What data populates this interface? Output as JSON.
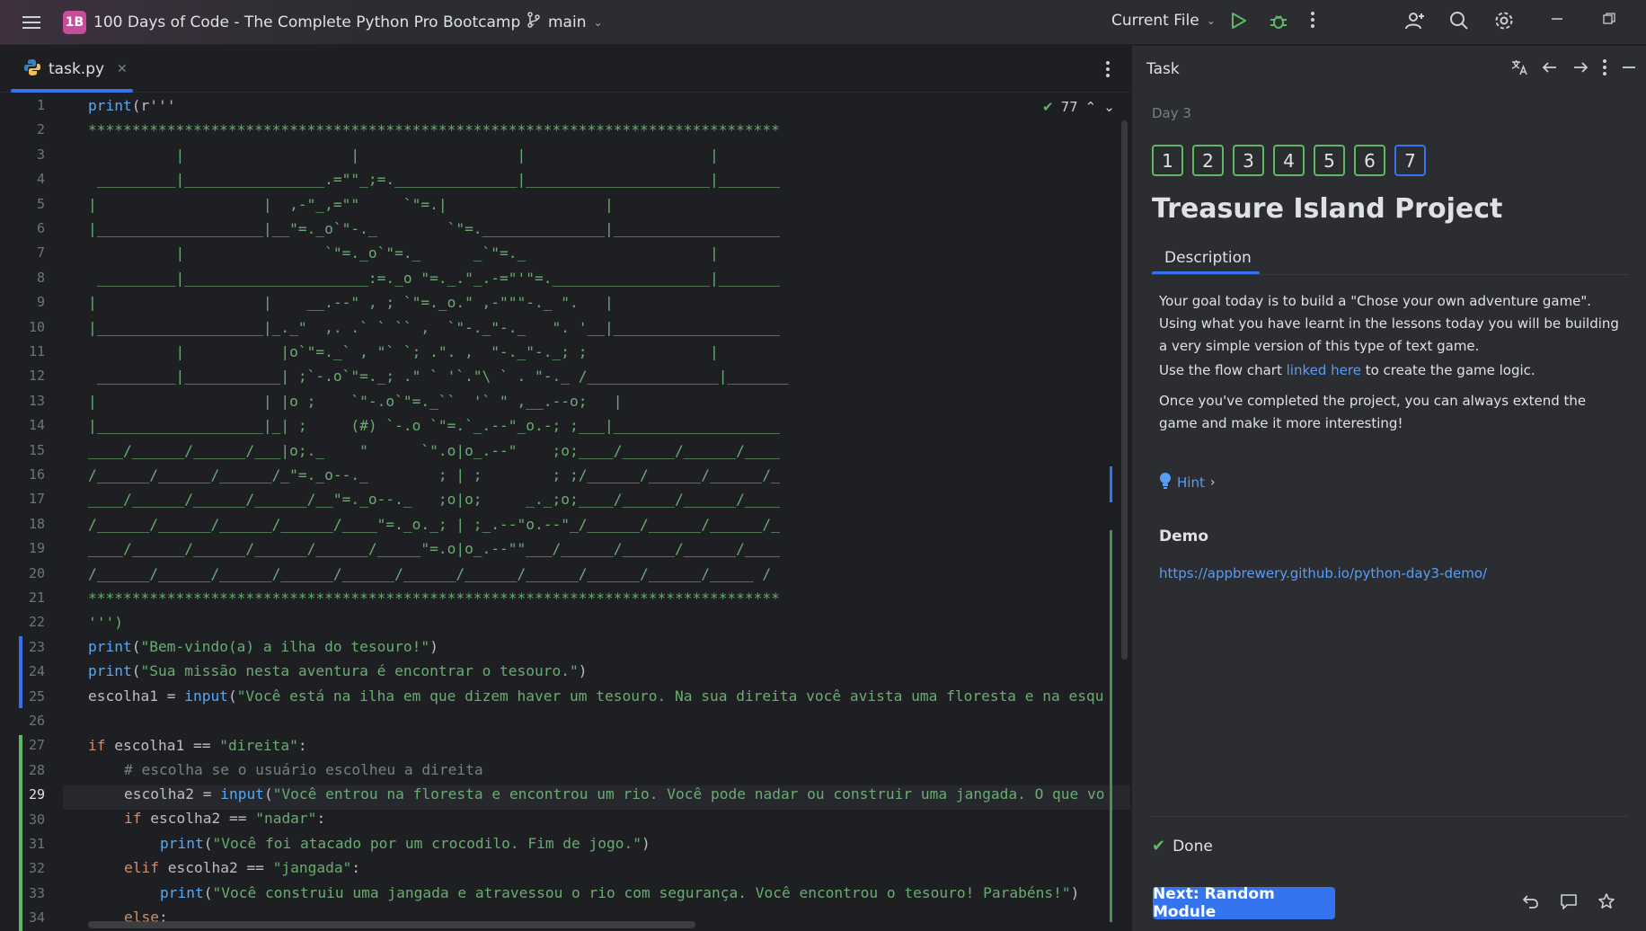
{
  "titlebar": {
    "project_badge": "1B",
    "project_name": "100 Days of Code - The Complete Python Pro Bootcamp",
    "branch": "main",
    "run_config": "Current File",
    "icons": [
      "hamburger-icon",
      "branch-icon",
      "chevron-down-icon",
      "run-icon",
      "debug-icon",
      "more-icon",
      "add-user-icon",
      "search-icon",
      "gear-icon",
      "minimize-icon",
      "restore-icon"
    ]
  },
  "editor": {
    "tab_label": "task.py",
    "inspection_count": "77",
    "current_line": 29,
    "line_numbers": [
      "1",
      "2",
      "3",
      "4",
      "5",
      "6",
      "7",
      "8",
      "9",
      "10",
      "11",
      "12",
      "13",
      "14",
      "15",
      "16",
      "17",
      "18",
      "19",
      "20",
      "21",
      "22",
      "23",
      "24",
      "25",
      "26",
      "27",
      "28",
      "29",
      "30",
      "31",
      "32",
      "33",
      "34"
    ],
    "art_lines": [
      "*******************************************************************************",
      "          |                   |                  |                     |",
      " _________|________________.=\"\"_;=.______________|_____________________|_______",
      "|                   |  ,-\"_,=\"\"     `\"=.|                  |",
      "|___________________|__\"=._o`\"-._        `\"=.______________|___________________",
      "          |                `\"=._o`\"=._      _`\"=._                     |",
      " _________|_____________________:=._o \"=._.\"_.-=\"'\"=.__________________|_______",
      "|                   |    __.--\" , ; `\"=._o.\" ,-\"\"\"-._ \".   |",
      "|___________________|_._\"  ,. .` ` `` ,  `\"-._\"-._   \". '__|___________________",
      "          |           |o`\"=._` , \"` `; .\". ,  \"-._\"-._; ;              |",
      " _________|___________| ;`-.o`\"=._; .\" ` '`.\"\\ ` . \"-._ /_______________|_______",
      "|                   | |o ;    `\"-.o`\"=._``  '` \" ,__.--o;   |",
      "|___________________|_| ;     (#) `-.o `\"=.`_.--\"_o.-; ;___|___________________",
      "____/______/______/___|o;._    \"      `\".o|o_.--\"    ;o;____/______/______/____",
      "/______/______/______/_\"=._o--._        ; | ;        ; ;/______/______/______/_",
      "____/______/______/______/__\"=._o--._   ;o|o;     _._;o;____/______/______/____",
      "/______/______/______/______/____\"=._o._; | ;_.--\"o.--\"_/______/______/______/_",
      "____/______/______/______/______/_____\"=.o|o_.--\"\"___/______/______/______/____",
      "/______/______/______/______/______/______/______/______/______/______/_____ /",
      "*******************************************************************************"
    ],
    "line1": {
      "fn": "print",
      "text": "(r'''"
    },
    "line22": "''')",
    "line23": {
      "fn": "print",
      "open": "(",
      "str": "\"Bem-vindo(a) a ilha do tesouro!\"",
      "close": ")"
    },
    "line24": {
      "fn": "print",
      "open": "(",
      "str": "\"Sua missão nesta aventura é encontrar o tesouro.\"",
      "close": ")"
    },
    "line25": {
      "var": "escolha1 = ",
      "fn": "input",
      "open": "(",
      "str": "\"Você está na ilha em que dizem haver um tesouro. Na sua direita você avista uma floresta e na esqu"
    },
    "line27": {
      "kw": "if",
      "text": " escolha1 == ",
      "str": "\"direita\"",
      "end": ":"
    },
    "line28": "# escolha se o usuário escolheu a direita",
    "line29": {
      "var": "escolha2 = ",
      "fn": "input",
      "open": "(",
      "str": "\"Você entrou na floresta e encontrou um rio. Você pode nadar ou construir uma jangada. O que vo"
    },
    "line30": {
      "kw": "if",
      "text": " escolha2 == ",
      "str": "\"nadar\"",
      "end": ":"
    },
    "line31": {
      "fn": "print",
      "open": "(",
      "str": "\"Você foi atacado por um crocodilo. Fim de jogo.\"",
      "close": ")"
    },
    "line32": {
      "kw": "elif",
      "text": " escolha2 == ",
      "str": "\"jangada\"",
      "end": ":"
    },
    "line33": {
      "fn": "print",
      "open": "(",
      "str": "\"Você construiu uma jangada e atravessou o rio com segurança. Você encontrou o tesouro! Parabéns!\"",
      "close": ")"
    },
    "line34": {
      "kw": "else",
      "end": ":"
    }
  },
  "task": {
    "header": "Task",
    "day": "Day 3",
    "steps": [
      "1",
      "2",
      "3",
      "4",
      "5",
      "6",
      "7"
    ],
    "active_step": "7",
    "title": "Treasure Island Project",
    "tab": "Description",
    "para1": "Your goal today is to build a \"Chose your own adventure game\". Using what you have learnt in the lessons today you will be building a very simple version of this type of text game.",
    "para2_before": "Use the flow chart ",
    "para2_link": "linked here",
    "para2_after": " to create the game logic.",
    "para3": "Once you've completed the project, you can always extend the game and make it more interesting!",
    "hint": "Hint",
    "demo_heading": "Demo",
    "demo_url": "https://appbrewery.github.io/python-day3-demo/",
    "done_label": "Done",
    "next_button": "Next: Random Module"
  },
  "colors": {
    "accent": "#3574f0",
    "success": "#5fb865",
    "string": "#6aab73",
    "keyword": "#cf8e6d",
    "function": "#56a8f5"
  }
}
